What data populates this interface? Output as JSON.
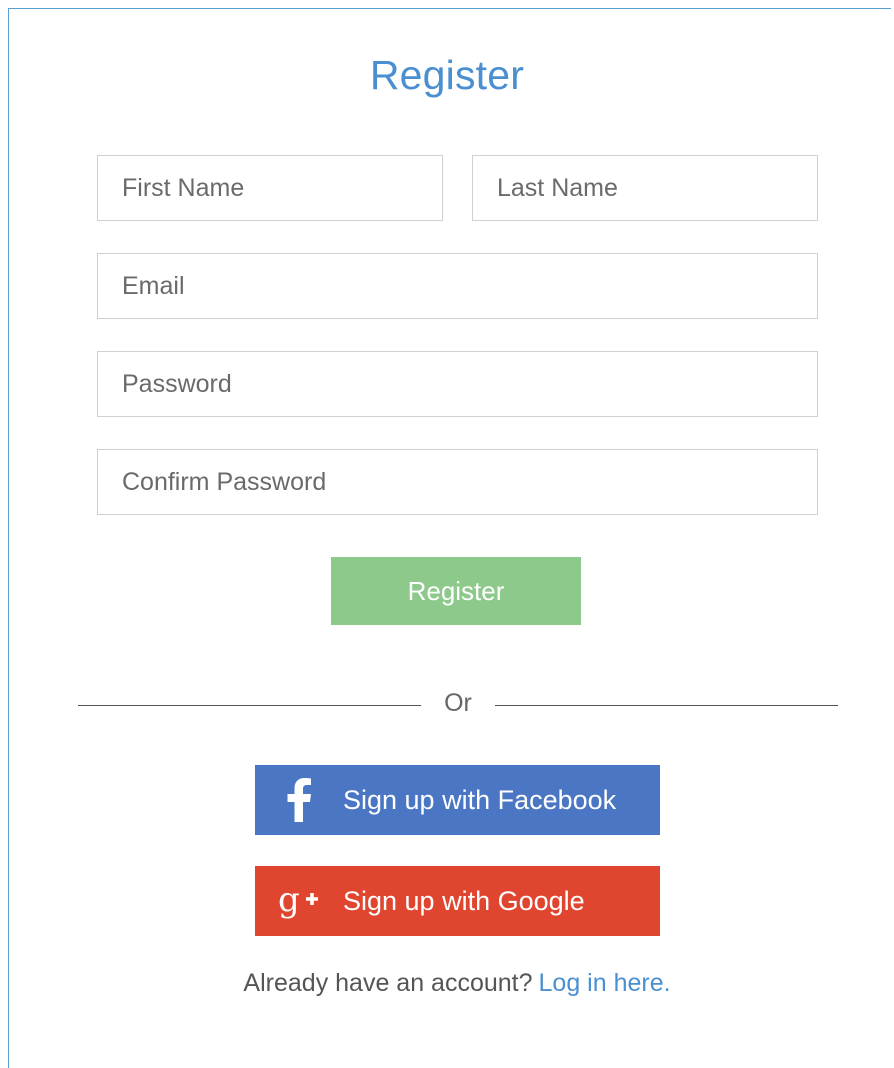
{
  "title": "Register",
  "form": {
    "first_name_placeholder": "First Name",
    "last_name_placeholder": "Last Name",
    "email_placeholder": "Email",
    "password_placeholder": "Password",
    "confirm_password_placeholder": "Confirm Password",
    "register_label": "Register"
  },
  "divider": {
    "text": "Or"
  },
  "social": {
    "facebook": {
      "label": "Sign up with Facebook",
      "icon": "facebook-icon",
      "color": "#4a76c4"
    },
    "google": {
      "label": "Sign up with Google",
      "icon": "google-plus-icon",
      "color": "#e0452f"
    }
  },
  "footer": {
    "prompt": "Already have an account?",
    "login_link": "Log in here."
  },
  "colors": {
    "accent": "#4a8fd0",
    "register_button": "#8cc98a",
    "border": "#5a9fd4"
  }
}
